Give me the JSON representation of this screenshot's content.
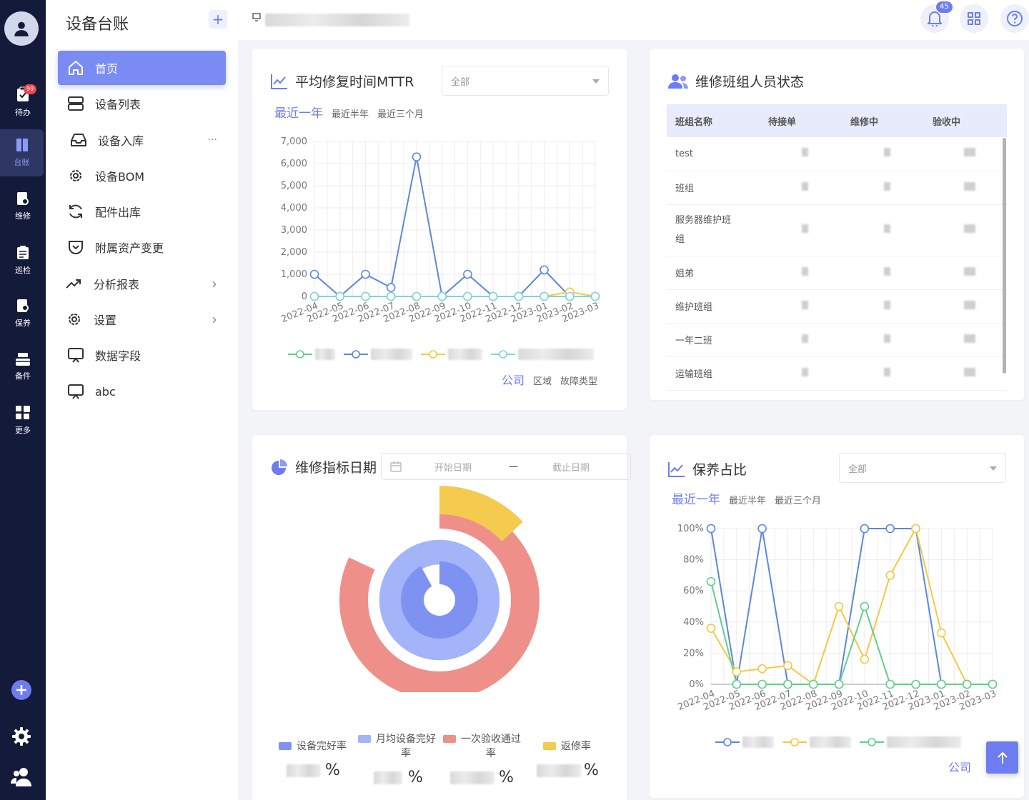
{
  "rail": {
    "badge": "99",
    "items": [
      {
        "label": "待办",
        "icon": "clipboard-icon"
      },
      {
        "label": "台账",
        "icon": "book-icon"
      },
      {
        "label": "维修",
        "icon": "wrench-doc-icon"
      },
      {
        "label": "巡检",
        "icon": "checklist-icon"
      },
      {
        "label": "保养",
        "icon": "maintenance-icon"
      },
      {
        "label": "备件",
        "icon": "parts-icon"
      },
      {
        "label": "更多",
        "icon": "grid-icon"
      }
    ]
  },
  "sidebar": {
    "title": "设备台账",
    "add": "+",
    "items": [
      {
        "label": "首页",
        "extra": ""
      },
      {
        "label": "设备列表",
        "extra": ""
      },
      {
        "label": "设备入库",
        "extra": "···"
      },
      {
        "label": "设备BOM",
        "extra": ""
      },
      {
        "label": "配件出库",
        "extra": ""
      },
      {
        "label": "附属资产变更",
        "extra": ""
      },
      {
        "label": "分析报表",
        "extra": "›"
      },
      {
        "label": "设置",
        "extra": "›"
      },
      {
        "label": "数据字段",
        "extra": ""
      },
      {
        "label": "abc",
        "extra": ""
      }
    ]
  },
  "topbar": {
    "notifications": "45"
  },
  "mttr": {
    "title": "平均修复时间MTTR",
    "select": "全部",
    "ranges": [
      "最近一年",
      "最近半年",
      "最近三个月"
    ],
    "tabs": [
      "公司",
      "区域",
      "故障类型"
    ]
  },
  "team": {
    "title": "维修班组人员状态",
    "columns": [
      "班组名称",
      "待接单",
      "维修中",
      "验收中"
    ],
    "rows": [
      "test",
      "班组",
      "服务器维护班",
      "组",
      "姐弟",
      "维护班组",
      "一年二班",
      "运输班组"
    ]
  },
  "indicator": {
    "title": "维修指标日期",
    "start_placeholder": "开始日期",
    "separator": "—",
    "end_placeholder": "截止日期",
    "legend": [
      {
        "label": "设备完好率",
        "color": "#7f92f2"
      },
      {
        "label": "月均设备完好",
        "label2": "率",
        "color": "#a4b4f8"
      },
      {
        "label": "一次验收通过",
        "label2": "率",
        "color": "#ee9089"
      },
      {
        "label": "返修率",
        "color": "#f5cb4f"
      }
    ],
    "unit": "%"
  },
  "upkeep": {
    "title": "保养占比",
    "select": "全部",
    "ranges": [
      "最近一年",
      "最近半年",
      "最近三个月"
    ],
    "tabs": [
      "公司"
    ]
  },
  "chart_data": [
    {
      "type": "line",
      "title": "平均修复时间MTTR",
      "x": [
        "2022-04",
        "2022-05",
        "2022-06",
        "2022-07",
        "2022-08",
        "2022-09",
        "2022-10",
        "2022-11",
        "2022-12",
        "2023-01",
        "2023-02",
        "2023-03"
      ],
      "ylim": [
        0,
        7000
      ],
      "yticks": [
        "0",
        "1,000",
        "2,000",
        "3,000",
        "4,000",
        "5,000",
        "6,000",
        "7,000"
      ],
      "grid": true,
      "series": [
        {
          "color": "#5fd08a",
          "values": [
            0,
            0,
            0,
            0,
            0,
            0,
            0,
            0,
            0,
            0,
            0,
            0
          ]
        },
        {
          "color": "#5b86e5",
          "values": [
            1000,
            0,
            1000,
            400,
            6300,
            0,
            1000,
            0,
            0,
            1200,
            0,
            0
          ]
        },
        {
          "color": "#f5c842",
          "values": [
            0,
            0,
            0,
            0,
            0,
            0,
            0,
            0,
            0,
            0,
            200,
            0
          ]
        },
        {
          "color": "#7fd3e6",
          "values": [
            0,
            0,
            0,
            0,
            0,
            0,
            0,
            0,
            0,
            0,
            0,
            0
          ]
        }
      ]
    },
    {
      "type": "pie",
      "title": "维修指标日期",
      "rings": [
        {
          "name": "设备完好率",
          "color": "#7f92f2",
          "fraction": 0.92
        },
        {
          "name": "月均设备完好率",
          "color": "#a4b4f8",
          "fraction": 1.0
        },
        {
          "name": "一次验收通过率",
          "color": "#ee9089",
          "fraction": 0.82
        },
        {
          "name": "返修率",
          "color": "#f5cb4f",
          "fraction": 0.13
        }
      ]
    },
    {
      "type": "line",
      "title": "保养占比",
      "x": [
        "2022-04",
        "2022-05",
        "2022-06",
        "2022-07",
        "2022-08",
        "2022-09",
        "2022-10",
        "2022-11",
        "2022-12",
        "2023-01",
        "2023-02",
        "2023-03"
      ],
      "ylim": [
        0,
        100
      ],
      "yticks": [
        "0%",
        "20%",
        "40%",
        "60%",
        "80%",
        "100%"
      ],
      "grid": true,
      "series": [
        {
          "color": "#5b86e5",
          "values": [
            100,
            0,
            100,
            0,
            0,
            0,
            100,
            100,
            100,
            0,
            0,
            0
          ]
        },
        {
          "color": "#f5c842",
          "values": [
            36,
            8,
            10,
            12,
            0,
            50,
            16,
            70,
            100,
            33,
            0,
            0
          ]
        },
        {
          "color": "#5fd08a",
          "values": [
            66,
            0,
            0,
            0,
            0,
            0,
            50,
            0,
            0,
            0,
            0,
            0
          ]
        }
      ]
    }
  ]
}
